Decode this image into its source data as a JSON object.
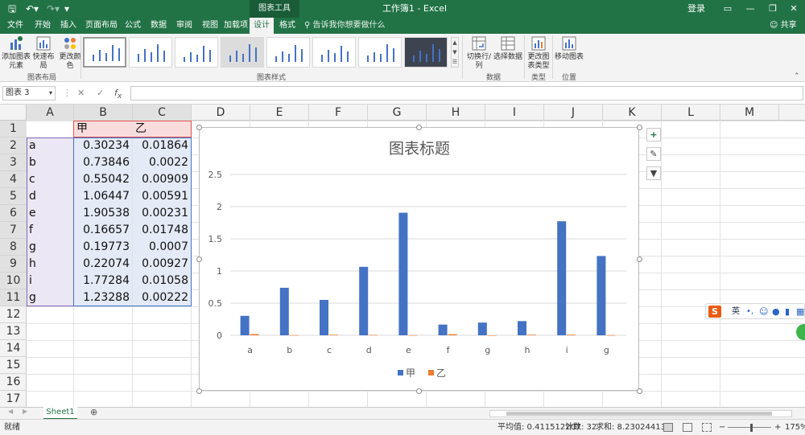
{
  "titlebar": {
    "context_tools": "图表工具",
    "document_title": "工作簿1 - Excel",
    "login": "登录"
  },
  "tabs": [
    {
      "label": "文件"
    },
    {
      "label": "开始"
    },
    {
      "label": "插入"
    },
    {
      "label": "页面布局"
    },
    {
      "label": "公式"
    },
    {
      "label": "数据"
    },
    {
      "label": "审阅"
    },
    {
      "label": "视图"
    },
    {
      "label": "加载项"
    },
    {
      "label": "设计"
    },
    {
      "label": "格式"
    }
  ],
  "tell_me": "告诉我你想要做什么",
  "share": "共享",
  "ribbon": {
    "add_element": "添加图表元素",
    "quick_layout": "快速布局",
    "change_colors": "更改颜色",
    "group_layout": "图表布局",
    "group_styles": "图表样式",
    "switch_rowcol": "切换行/列",
    "select_data": "选择数据",
    "group_data": "数据",
    "change_type": "更改图表类型",
    "group_type": "类型",
    "move_chart": "移动图表",
    "group_location": "位置"
  },
  "namebox": "图表 3",
  "columns": [
    "A",
    "B",
    "C",
    "D",
    "E",
    "F",
    "G",
    "H",
    "I",
    "J",
    "K",
    "L",
    "M"
  ],
  "rows": [
    "1",
    "2",
    "3",
    "4",
    "5",
    "6",
    "7",
    "8",
    "9",
    "10",
    "11",
    "12",
    "13",
    "14",
    "15",
    "16",
    "17"
  ],
  "table": {
    "headers": [
      "甲",
      "乙"
    ],
    "rows": [
      {
        "cat": "a",
        "v1": "0.30234",
        "v2": "0.01864"
      },
      {
        "cat": "b",
        "v1": "0.73846",
        "v2": "0.0022"
      },
      {
        "cat": "c",
        "v1": "0.55042",
        "v2": "0.00909"
      },
      {
        "cat": "d",
        "v1": "1.06447",
        "v2": "0.00591"
      },
      {
        "cat": "e",
        "v1": "1.90538",
        "v2": "0.00231"
      },
      {
        "cat": "f",
        "v1": "0.16657",
        "v2": "0.01748"
      },
      {
        "cat": "g",
        "v1": "0.19773",
        "v2": "0.0007"
      },
      {
        "cat": "h",
        "v1": "0.22074",
        "v2": "0.00927"
      },
      {
        "cat": "i",
        "v1": "1.77284",
        "v2": "0.01058"
      },
      {
        "cat": "g",
        "v1": "1.23288",
        "v2": "0.00222"
      }
    ]
  },
  "chart_data": {
    "type": "bar",
    "title": "图表标题",
    "categories": [
      "a",
      "b",
      "c",
      "d",
      "e",
      "f",
      "g",
      "h",
      "i",
      "g"
    ],
    "series": [
      {
        "name": "甲",
        "color": "#4472c4",
        "values": [
          0.30234,
          0.73846,
          0.55042,
          1.06447,
          1.90538,
          0.16657,
          0.19773,
          0.22074,
          1.77284,
          1.23288
        ]
      },
      {
        "name": "乙",
        "color": "#ed7d31",
        "values": [
          0.01864,
          0.0022,
          0.00909,
          0.00591,
          0.00231,
          0.01748,
          0.0007,
          0.00927,
          0.01058,
          0.00222
        ]
      }
    ],
    "yticks": [
      "0",
      "0.5",
      "1",
      "1.5",
      "2",
      "2.5"
    ],
    "ylim": [
      0,
      2.5
    ],
    "grid": true,
    "legend": "bottom"
  },
  "sheet_tab": "Sheet1",
  "status": {
    "ready": "就绪",
    "average": "平均值: 0.411512207",
    "count": "计数: 32",
    "sum": "求和: 8.230244135",
    "zoom": "175%"
  },
  "ime": {
    "lang": "英"
  },
  "colors": {
    "excel_green": "#217346",
    "series1": "#4472c4",
    "series2": "#ed7d31"
  }
}
